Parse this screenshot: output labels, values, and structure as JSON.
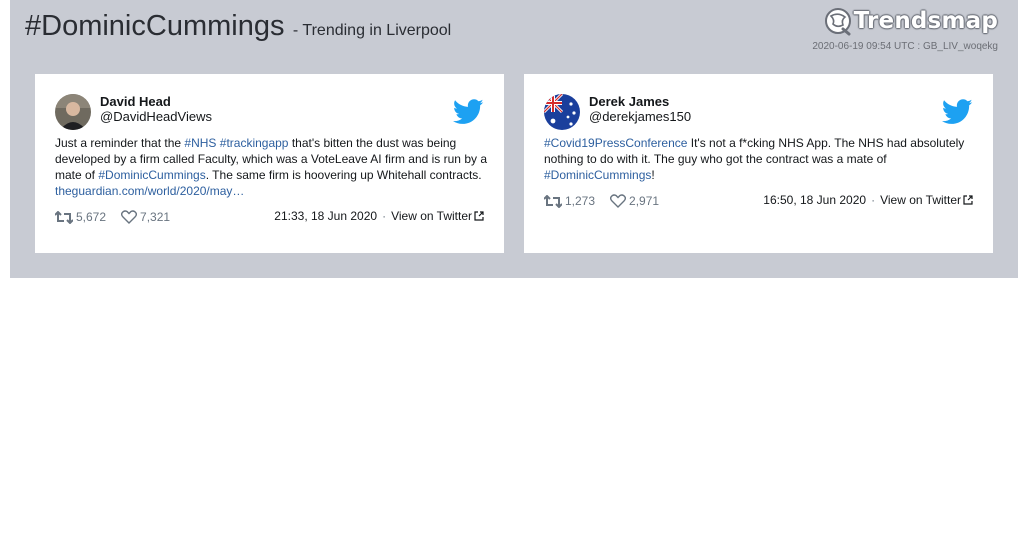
{
  "header": {
    "hashtag": "#DominicCummings",
    "subtitle": "- Trending in Liverpool",
    "logo_text": "Trendsmap",
    "meta": "2020-06-19 09:54 UTC : GB_LIV_woqekg"
  },
  "tweets": [
    {
      "name": "David Head",
      "handle": "@DavidHeadViews",
      "text_parts": [
        {
          "t": "Just a reminder that the ",
          "k": "plain"
        },
        {
          "t": "#NHS",
          "k": "tag"
        },
        {
          "t": " ",
          "k": "plain"
        },
        {
          "t": "#trackingapp",
          "k": "tag"
        },
        {
          "t": " that's bitten the dust was being developed by a firm called Faculty, which was a VoteLeave AI firm and is run by a mate of ",
          "k": "plain"
        },
        {
          "t": "#DominicCummings",
          "k": "tag"
        },
        {
          "t": ". The same firm is hoovering up Whitehall contracts. ",
          "k": "plain"
        },
        {
          "t": "theguardian.com/world/2020/may…",
          "k": "link"
        }
      ],
      "retweets": "5,672",
      "likes": "7,321",
      "time": "21:33, 18 Jun 2020",
      "view": "View on Twitter"
    },
    {
      "name": "Derek James",
      "handle": "@derekjames150",
      "text_parts": [
        {
          "t": "#Covid19PressConference",
          "k": "tag"
        },
        {
          "t": " It's not a f*cking NHS App. The NHS had absolutely nothing to do with it. The guy who got the contract was a mate of ",
          "k": "plain"
        },
        {
          "t": "#DominicCummings",
          "k": "tag"
        },
        {
          "t": "!",
          "k": "plain"
        }
      ],
      "retweets": "1,273",
      "likes": "2,971",
      "time": "16:50, 18 Jun 2020",
      "view": "View on Twitter"
    }
  ],
  "colors": {
    "banner": "#c8cbd3",
    "twitter_blue": "#1da1f2",
    "tag": "#2d5f9f"
  },
  "icons": {
    "bird": "twitter-bird-icon",
    "retweet": "retweet-icon",
    "like": "heart-icon",
    "external": "external-link-icon",
    "logo": "globe-icon"
  }
}
